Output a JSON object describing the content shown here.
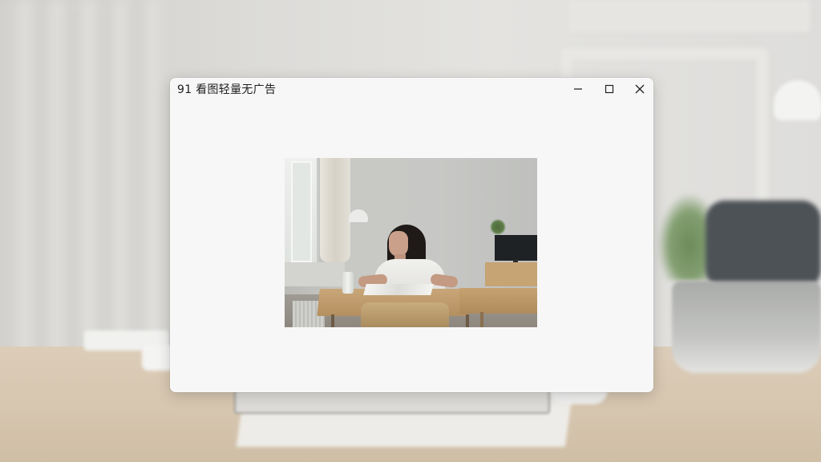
{
  "window": {
    "title": "91 看图轻量无广告"
  },
  "controls": {
    "minimize_icon": "minimize-icon",
    "maximize_icon": "maximize-icon",
    "close_icon": "close-icon"
  },
  "viewer": {
    "image": "photo-woman-reading-at-table"
  },
  "colors": {
    "window_bg": "#f7f7f7",
    "title_text": "#1f1f1f"
  }
}
